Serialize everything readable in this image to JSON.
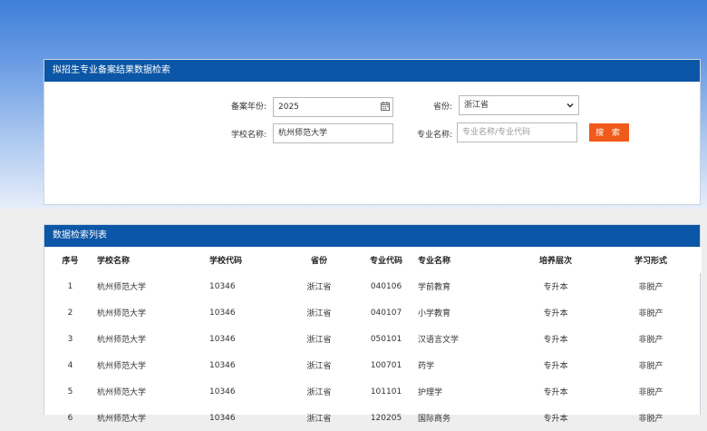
{
  "search": {
    "title": "拟招生专业备案结果数据检索",
    "year_label": "备案年份:",
    "year_value": "2025",
    "province_label": "省份:",
    "province_value": "浙江省",
    "school_label": "学校名称:",
    "school_value": "杭州师范大学",
    "major_label": "专业名称:",
    "major_placeholder": "专业名称/专业代码",
    "search_button": "搜 索"
  },
  "results": {
    "title": "数据检索列表",
    "columns": [
      "序号",
      "学校名称",
      "学校代码",
      "省份",
      "专业代码",
      "专业名称",
      "培养层次",
      "学习形式"
    ],
    "rows": [
      [
        "1",
        "杭州师范大学",
        "10346",
        "浙江省",
        "040106",
        "学前教育",
        "专升本",
        "非脱产"
      ],
      [
        "2",
        "杭州师范大学",
        "10346",
        "浙江省",
        "040107",
        "小学教育",
        "专升本",
        "非脱产"
      ],
      [
        "3",
        "杭州师范大学",
        "10346",
        "浙江省",
        "050101",
        "汉语言文学",
        "专升本",
        "非脱产"
      ],
      [
        "4",
        "杭州师范大学",
        "10346",
        "浙江省",
        "100701",
        "药学",
        "专升本",
        "非脱产"
      ],
      [
        "5",
        "杭州师范大学",
        "10346",
        "浙江省",
        "101101",
        "护理学",
        "专升本",
        "非脱产"
      ],
      [
        "6",
        "杭州师范大学",
        "10346",
        "浙江省",
        "120205",
        "国际商务",
        "专升本",
        "非脱产"
      ]
    ]
  }
}
